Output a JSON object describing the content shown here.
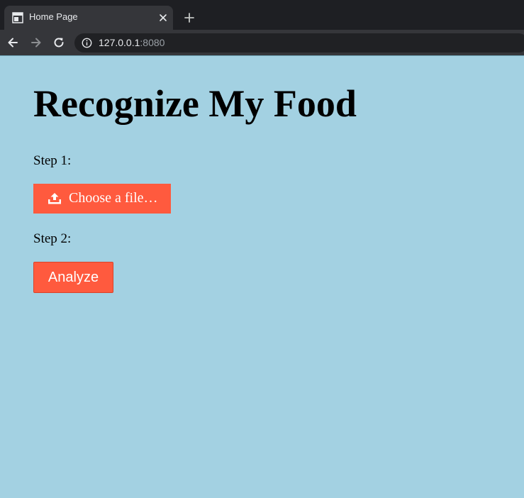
{
  "browser": {
    "tab": {
      "title": "Home Page"
    },
    "address": {
      "host": "127.0.0.1",
      "port": ":8080"
    }
  },
  "page": {
    "title": "Recognize My Food",
    "step1_label": "Step 1:",
    "file_button_label": "Choose a file…",
    "step2_label": "Step 2:",
    "analyze_button_label": "Analyze"
  },
  "colors": {
    "page_background": "#a3d1e2",
    "button_accent": "#ff5a3e",
    "chrome_dark": "#1e1f23",
    "chrome_toolbar": "#35363a"
  },
  "icons": {
    "tab_favicon": "page-favicon-icon",
    "tab_close": "close-icon",
    "new_tab": "plus-icon",
    "back": "arrow-left-icon",
    "forward": "arrow-right-icon",
    "reload": "reload-icon",
    "site_info": "info-icon",
    "upload": "upload-icon"
  }
}
